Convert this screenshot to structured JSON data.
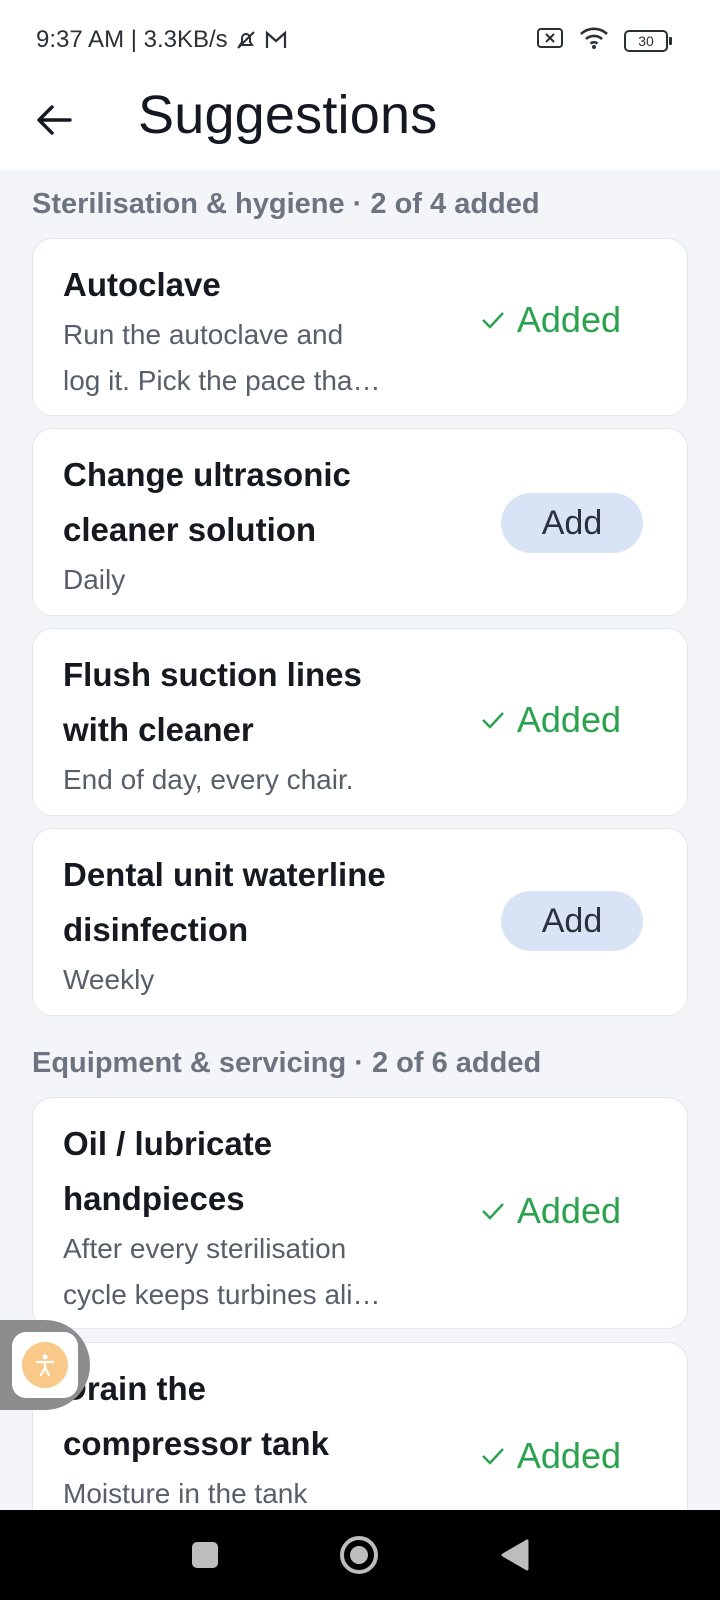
{
  "status_bar": {
    "time_speed": "9:37 AM | 3.3KB/s",
    "battery": "30"
  },
  "header": {
    "title": "Suggestions"
  },
  "sections": [
    {
      "title": "Sterilisation & hygiene · 2 of 4 added",
      "items": [
        {
          "title_lines": [
            "Autoclave"
          ],
          "desc_lines": [
            "Run the autoclave and",
            "log it. Pick the pace tha…"
          ],
          "status": "Added"
        },
        {
          "title_lines": [
            "Change ultrasonic",
            "cleaner solution"
          ],
          "desc_lines": [
            "Daily"
          ],
          "status": "Add"
        },
        {
          "title_lines": [
            "Flush suction lines",
            "with cleaner"
          ],
          "desc_lines": [
            "End of day, every chair."
          ],
          "status": "Added"
        },
        {
          "title_lines": [
            "Dental unit waterline",
            "disinfection"
          ],
          "desc_lines": [
            "Weekly"
          ],
          "status": "Add"
        }
      ]
    },
    {
      "title": "Equipment & servicing · 2 of 6 added",
      "items": [
        {
          "title_lines": [
            "Oil / lubricate",
            "handpieces"
          ],
          "desc_lines": [
            "After every sterilisation",
            "cycle keeps turbines ali…"
          ],
          "status": "Added"
        },
        {
          "title_lines": [
            "Drain the",
            "compressor tank"
          ],
          "desc_lines": [
            "Moisture in the tank"
          ],
          "status": "Added"
        }
      ]
    }
  ],
  "colors": {
    "added_green": "#2aa24e",
    "add_button_bg": "#d8e4f5",
    "page_bg": "#f3f5f8"
  }
}
